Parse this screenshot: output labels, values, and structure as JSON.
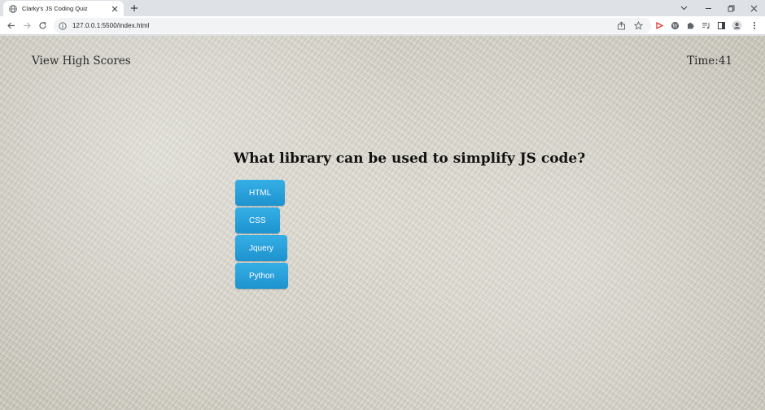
{
  "browser": {
    "tab_title": "Clarky's JS Coding Quiz",
    "url": "127.0.0.1:5500/index.html",
    "icons": [
      "globe-icon",
      "close-icon",
      "plus-icon",
      "chevron-down-icon",
      "minimize-icon",
      "restore-icon",
      "back-arrow-icon",
      "forward-arrow-icon",
      "reload-icon",
      "info-icon",
      "share-icon",
      "star-icon",
      "extension-red-icon",
      "wordpress-icon",
      "puzzle-icon",
      "playlist-icon",
      "sidepanel-icon",
      "profile-icon",
      "kebab-menu-icon"
    ]
  },
  "header": {
    "view_high_scores": "View High Scores",
    "timer": "Time:41"
  },
  "quiz": {
    "question": "What library can be used to simplify JS code?",
    "answers": [
      "HTML",
      "CSS",
      "Jquery",
      "Python"
    ],
    "button_color": "#24a0dc"
  }
}
